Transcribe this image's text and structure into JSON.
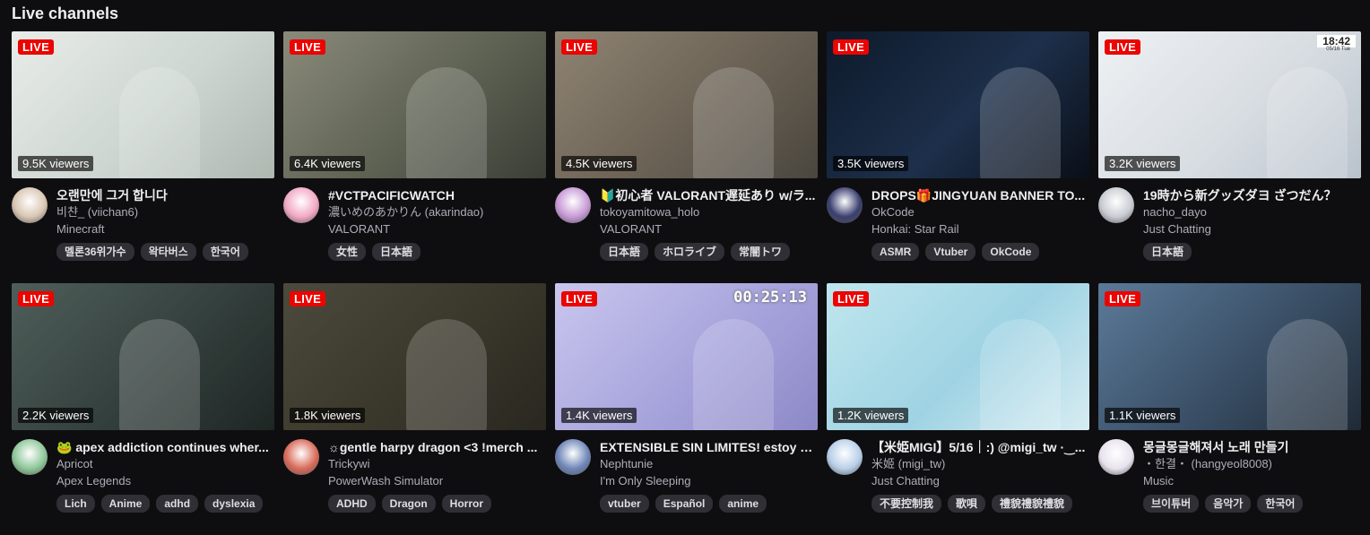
{
  "section": {
    "title": "Live channels"
  },
  "live_label": "LIVE",
  "rows": [
    [
      {
        "title": "오랜만에 그거 합니다",
        "channel": "비챤_ (viichan6)",
        "category": "Minecraft",
        "viewers": "9.5K viewers",
        "tags": [
          "멜론36위가수",
          "왁타버스",
          "한국어"
        ],
        "thumb_colors": [
          "#e9ece8",
          "#cdd6d1",
          "#aeb7b0"
        ],
        "avatar_color": "#d9c6b3"
      },
      {
        "title": "#VCTPACIFICWATCH",
        "channel": "濃いめのあかりん (akarindao)",
        "category": "VALORANT",
        "viewers": "6.4K viewers",
        "tags": [
          "女性",
          "日本語"
        ],
        "thumb_colors": [
          "#8a8a7a",
          "#5e6253",
          "#3a3f36"
        ],
        "avatar_color": "#f2a9c4"
      },
      {
        "title": "🔰初心者 VALORANT遅延あり w/ラ...",
        "channel": "tokoyamitowa_holo",
        "category": "VALORANT",
        "viewers": "4.5K viewers",
        "tags": [
          "日本語",
          "ホロライブ",
          "常闇トワ"
        ],
        "thumb_colors": [
          "#8f8473",
          "#6b6255",
          "#4a463e"
        ],
        "avatar_color": "#c79ad6"
      },
      {
        "title": "DROPS🎁JINGYUAN BANNER TO...",
        "channel": "OkCode",
        "category": "Honkai: Star Rail",
        "viewers": "3.5K viewers",
        "tags": [
          "ASMR",
          "Vtuber",
          "OkCode"
        ],
        "thumb_colors": [
          "#0d1a2a",
          "#1d2f4a",
          "#0a0f18"
        ],
        "avatar_color": "#3a3f6e"
      },
      {
        "title": "19時から新グッズダヨ ざつだん？",
        "channel": "nacho_dayo",
        "category": "Just Chatting",
        "viewers": "3.2K viewers",
        "tags": [
          "日本語"
        ],
        "thumb_colors": [
          "#eef1f4",
          "#d8dde2",
          "#b9c3cc"
        ],
        "avatar_color": "#c8ccd2",
        "clock": "18:42",
        "clock_date": "05/16 Tue"
      }
    ],
    [
      {
        "title": "🐸 apex addiction continues wher...",
        "channel": "Apricot",
        "category": "Apex Legends",
        "viewers": "2.2K viewers",
        "tags": [
          "Lich",
          "Anime",
          "adhd",
          "dyslexia"
        ],
        "thumb_colors": [
          "#4f5e5a",
          "#34403d",
          "#1e2624"
        ],
        "avatar_color": "#8fc79a"
      },
      {
        "title": "☼gentle harpy dragon <3 !merch ...",
        "channel": "Trickywi",
        "category": "PowerWash Simulator",
        "viewers": "1.8K viewers",
        "tags": [
          "ADHD",
          "Dragon",
          "Horror"
        ],
        "thumb_colors": [
          "#4b4a3c",
          "#3a372b",
          "#2a2720"
        ],
        "avatar_color": "#d96b5a"
      },
      {
        "title": "EXTENSIBLE SIN LIMITES! estoy d...",
        "channel": "Nephtunie",
        "category": "I'm Only Sleeping",
        "viewers": "1.4K viewers",
        "tags": [
          "vtuber",
          "Español",
          "anime"
        ],
        "thumb_colors": [
          "#c9c6ee",
          "#a7a4dc",
          "#8d89c8"
        ],
        "avatar_color": "#6f86b8",
        "timer": "00:25:13"
      },
      {
        "title": "【米姫MIGI】5/16｜:) @migi_tw ·‿...",
        "channel": "米姬 (migi_tw)",
        "category": "Just Chatting",
        "viewers": "1.2K viewers",
        "tags": [
          "不要控制我",
          "歌唄",
          "禮貌禮貌禮貌"
        ],
        "thumb_colors": [
          "#bfe6ee",
          "#9fd3e3",
          "#d7ecf2"
        ],
        "avatar_color": "#b9cfe8"
      },
      {
        "title": "몽글몽글해져서 노래 만들기",
        "channel": "・한결・ (hangyeol8008)",
        "category": "Music",
        "viewers": "1.1K viewers",
        "tags": [
          "브이튜버",
          "음악가",
          "한국어"
        ],
        "thumb_colors": [
          "#5b7a99",
          "#3a4f66",
          "#1f2a36"
        ],
        "avatar_color": "#e8e3ee"
      }
    ]
  ]
}
